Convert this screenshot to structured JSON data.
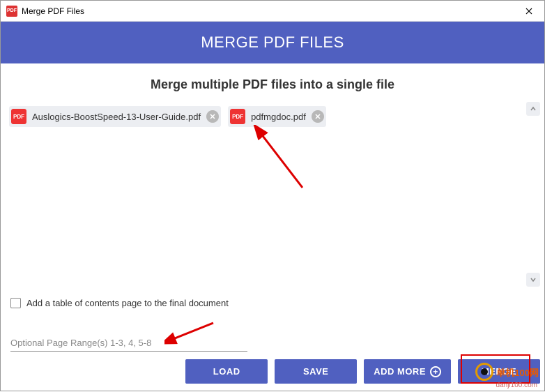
{
  "titlebar": {
    "icon_label": "PDF",
    "title": "Merge PDF Files"
  },
  "header": {
    "title": "MERGE PDF FILES"
  },
  "main": {
    "subtitle": "Merge multiple PDF files into a single file",
    "files": [
      {
        "name": "Auslogics-BoostSpeed-13-User-Guide.pdf",
        "icon_label": "PDF"
      },
      {
        "name": "pdfmgdoc.pdf",
        "icon_label": "PDF"
      }
    ],
    "toc_checkbox": {
      "checked": false,
      "label": "Add a table of contents page to the final document"
    },
    "page_range": {
      "placeholder": "Optional Page Range(s) 1-3, 4, 5-8",
      "value": ""
    }
  },
  "buttons": {
    "load": "LOAD",
    "save": "SAVE",
    "add_more": "ADD MORE",
    "merge": "MERGE"
  },
  "watermark": {
    "text": "单机100网",
    "sub": "danji100.com"
  }
}
